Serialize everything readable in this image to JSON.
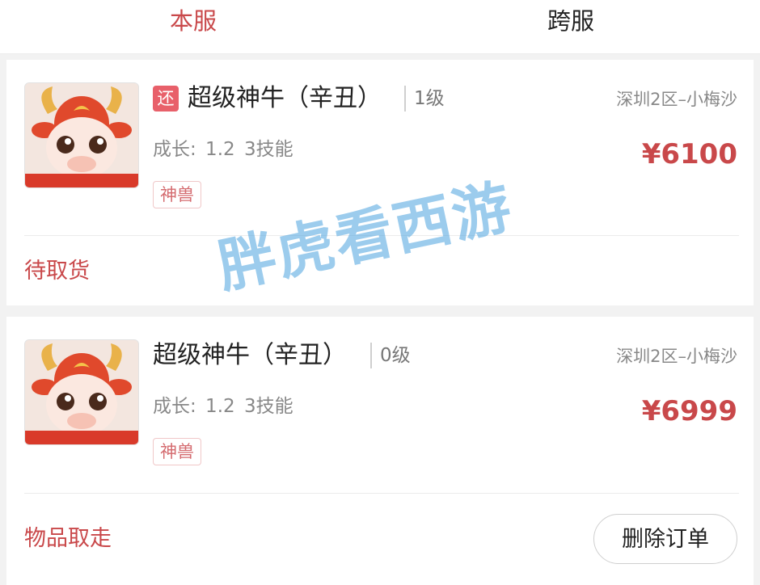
{
  "tabs": {
    "local": "本服",
    "cross": "跨服"
  },
  "orders": [
    {
      "return_tag": "还",
      "name": "超级神牛（辛丑）",
      "level": "1级",
      "server": "深圳2区–小梅沙",
      "growth": "成长: 1.2 3技能",
      "price": "¥6100",
      "type_tag": "神兽",
      "status": "待取货"
    },
    {
      "name": "超级神牛（辛丑）",
      "level": "0级",
      "server": "深圳2区–小梅沙",
      "growth": "成长: 1.2 3技能",
      "price": "¥6999",
      "type_tag": "神兽",
      "status": "物品取走",
      "delete_label": "删除订单"
    }
  ],
  "watermark": "胖虎看西游",
  "colors": {
    "accent": "#c9484a",
    "return_tag_bg": "#e8606a",
    "watermark": "#5aaae1"
  },
  "icons": {
    "thumbnail": "ox-pet-avatar"
  }
}
